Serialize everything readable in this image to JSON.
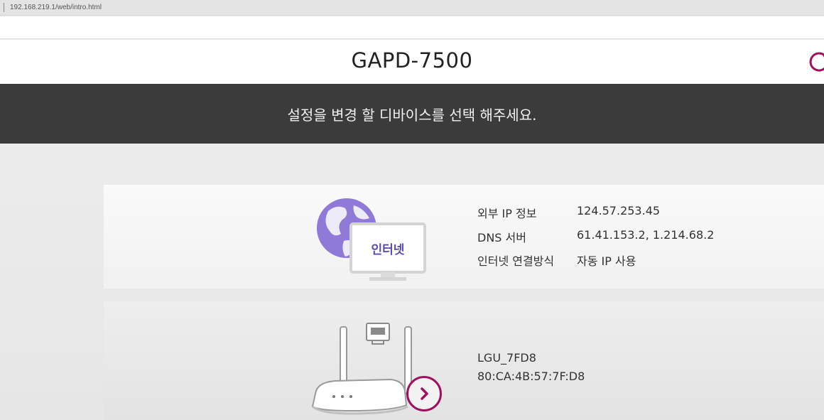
{
  "browser": {
    "url": "192.168.219.1/web/intro.html"
  },
  "header": {
    "title": "GAPD-7500",
    "refresh_icon": "refresh-icon"
  },
  "banner": {
    "text": "설정을 변경 할 디바이스를 선택 해주세요."
  },
  "internet_card": {
    "icon_label": "인터넷",
    "rows": [
      {
        "label": "외부 IP 정보",
        "value": "124.57.253.45"
      },
      {
        "label": "DNS 서버",
        "value": "61.41.153.2, 1.214.68.2"
      },
      {
        "label": "인터넷 연결방식",
        "value": "자동 IP 사용"
      }
    ]
  },
  "router_card": {
    "ssid": "LGU_7FD8",
    "mac": "80:CA:4B:57:7F:D8",
    "next_icon": "chevron-right-icon"
  },
  "colors": {
    "accent": "#a0105f",
    "banner_bg": "#3b3b3b",
    "globe": "#8f7ad8"
  }
}
